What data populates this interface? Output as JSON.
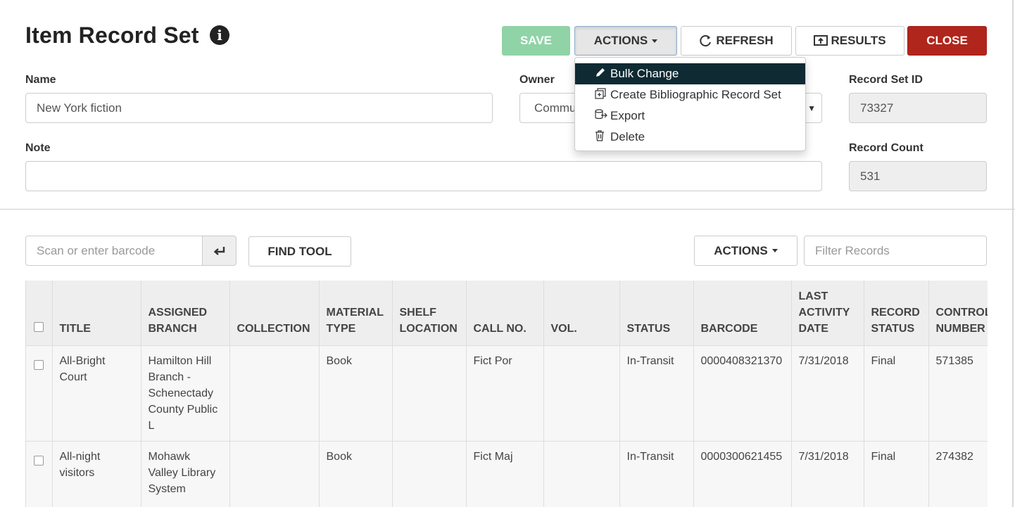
{
  "page": {
    "title": "Item Record Set",
    "info_icon": "info-circle-icon"
  },
  "toolbar": {
    "save_label": "SAVE",
    "actions_label": "ACTIONS",
    "refresh_label": "REFRESH",
    "results_label": "RESULTS",
    "close_label": "CLOSE",
    "colors": {
      "save": "#8fd3a6",
      "close": "#b0251c"
    }
  },
  "actions_menu": {
    "items": [
      {
        "label": "Bulk Change",
        "icon": "pencil-icon"
      },
      {
        "label": "Create Bibliographic Record Set",
        "icon": "copy-plus-icon"
      },
      {
        "label": "Export",
        "icon": "database-export-icon"
      },
      {
        "label": "Delete",
        "icon": "trash-icon"
      }
    ]
  },
  "form": {
    "name_label": "Name",
    "name_value": "New York fiction",
    "owner_label": "Owner",
    "owner_value": "Commu",
    "record_set_id_label": "Record Set ID",
    "record_set_id_value": "73327",
    "note_label": "Note",
    "note_value": "",
    "record_count_label": "Record Count",
    "record_count_value": "531"
  },
  "list_toolbar": {
    "barcode_placeholder": "Scan or enter barcode",
    "find_tool_label": "FIND TOOL",
    "actions_label": "ACTIONS",
    "filter_placeholder": "Filter Records"
  },
  "table": {
    "headers": [
      "TITLE",
      "ASSIGNED BRANCH",
      "COLLECTION",
      "MATERIAL TYPE",
      "SHELF LOCATION",
      "CALL NO.",
      "VOL.",
      "STATUS",
      "BARCODE",
      "LAST ACTIVITY DATE",
      "RECORD STATUS",
      "CONTROL NUMBER"
    ],
    "rows": [
      [
        "All-Bright Court",
        "Hamilton Hill Branch - Schenectady County Public L",
        "",
        "Book",
        "",
        "Fict Por",
        "",
        "In-Transit",
        "0000408321370",
        "7/31/2018",
        "Final",
        "571385"
      ],
      [
        "All-night visitors",
        "Mohawk Valley Library System",
        "",
        "Book",
        "",
        "Fict Maj",
        "",
        "In-Transit",
        "0000300621455",
        "7/31/2018",
        "Final",
        "274382"
      ]
    ]
  }
}
